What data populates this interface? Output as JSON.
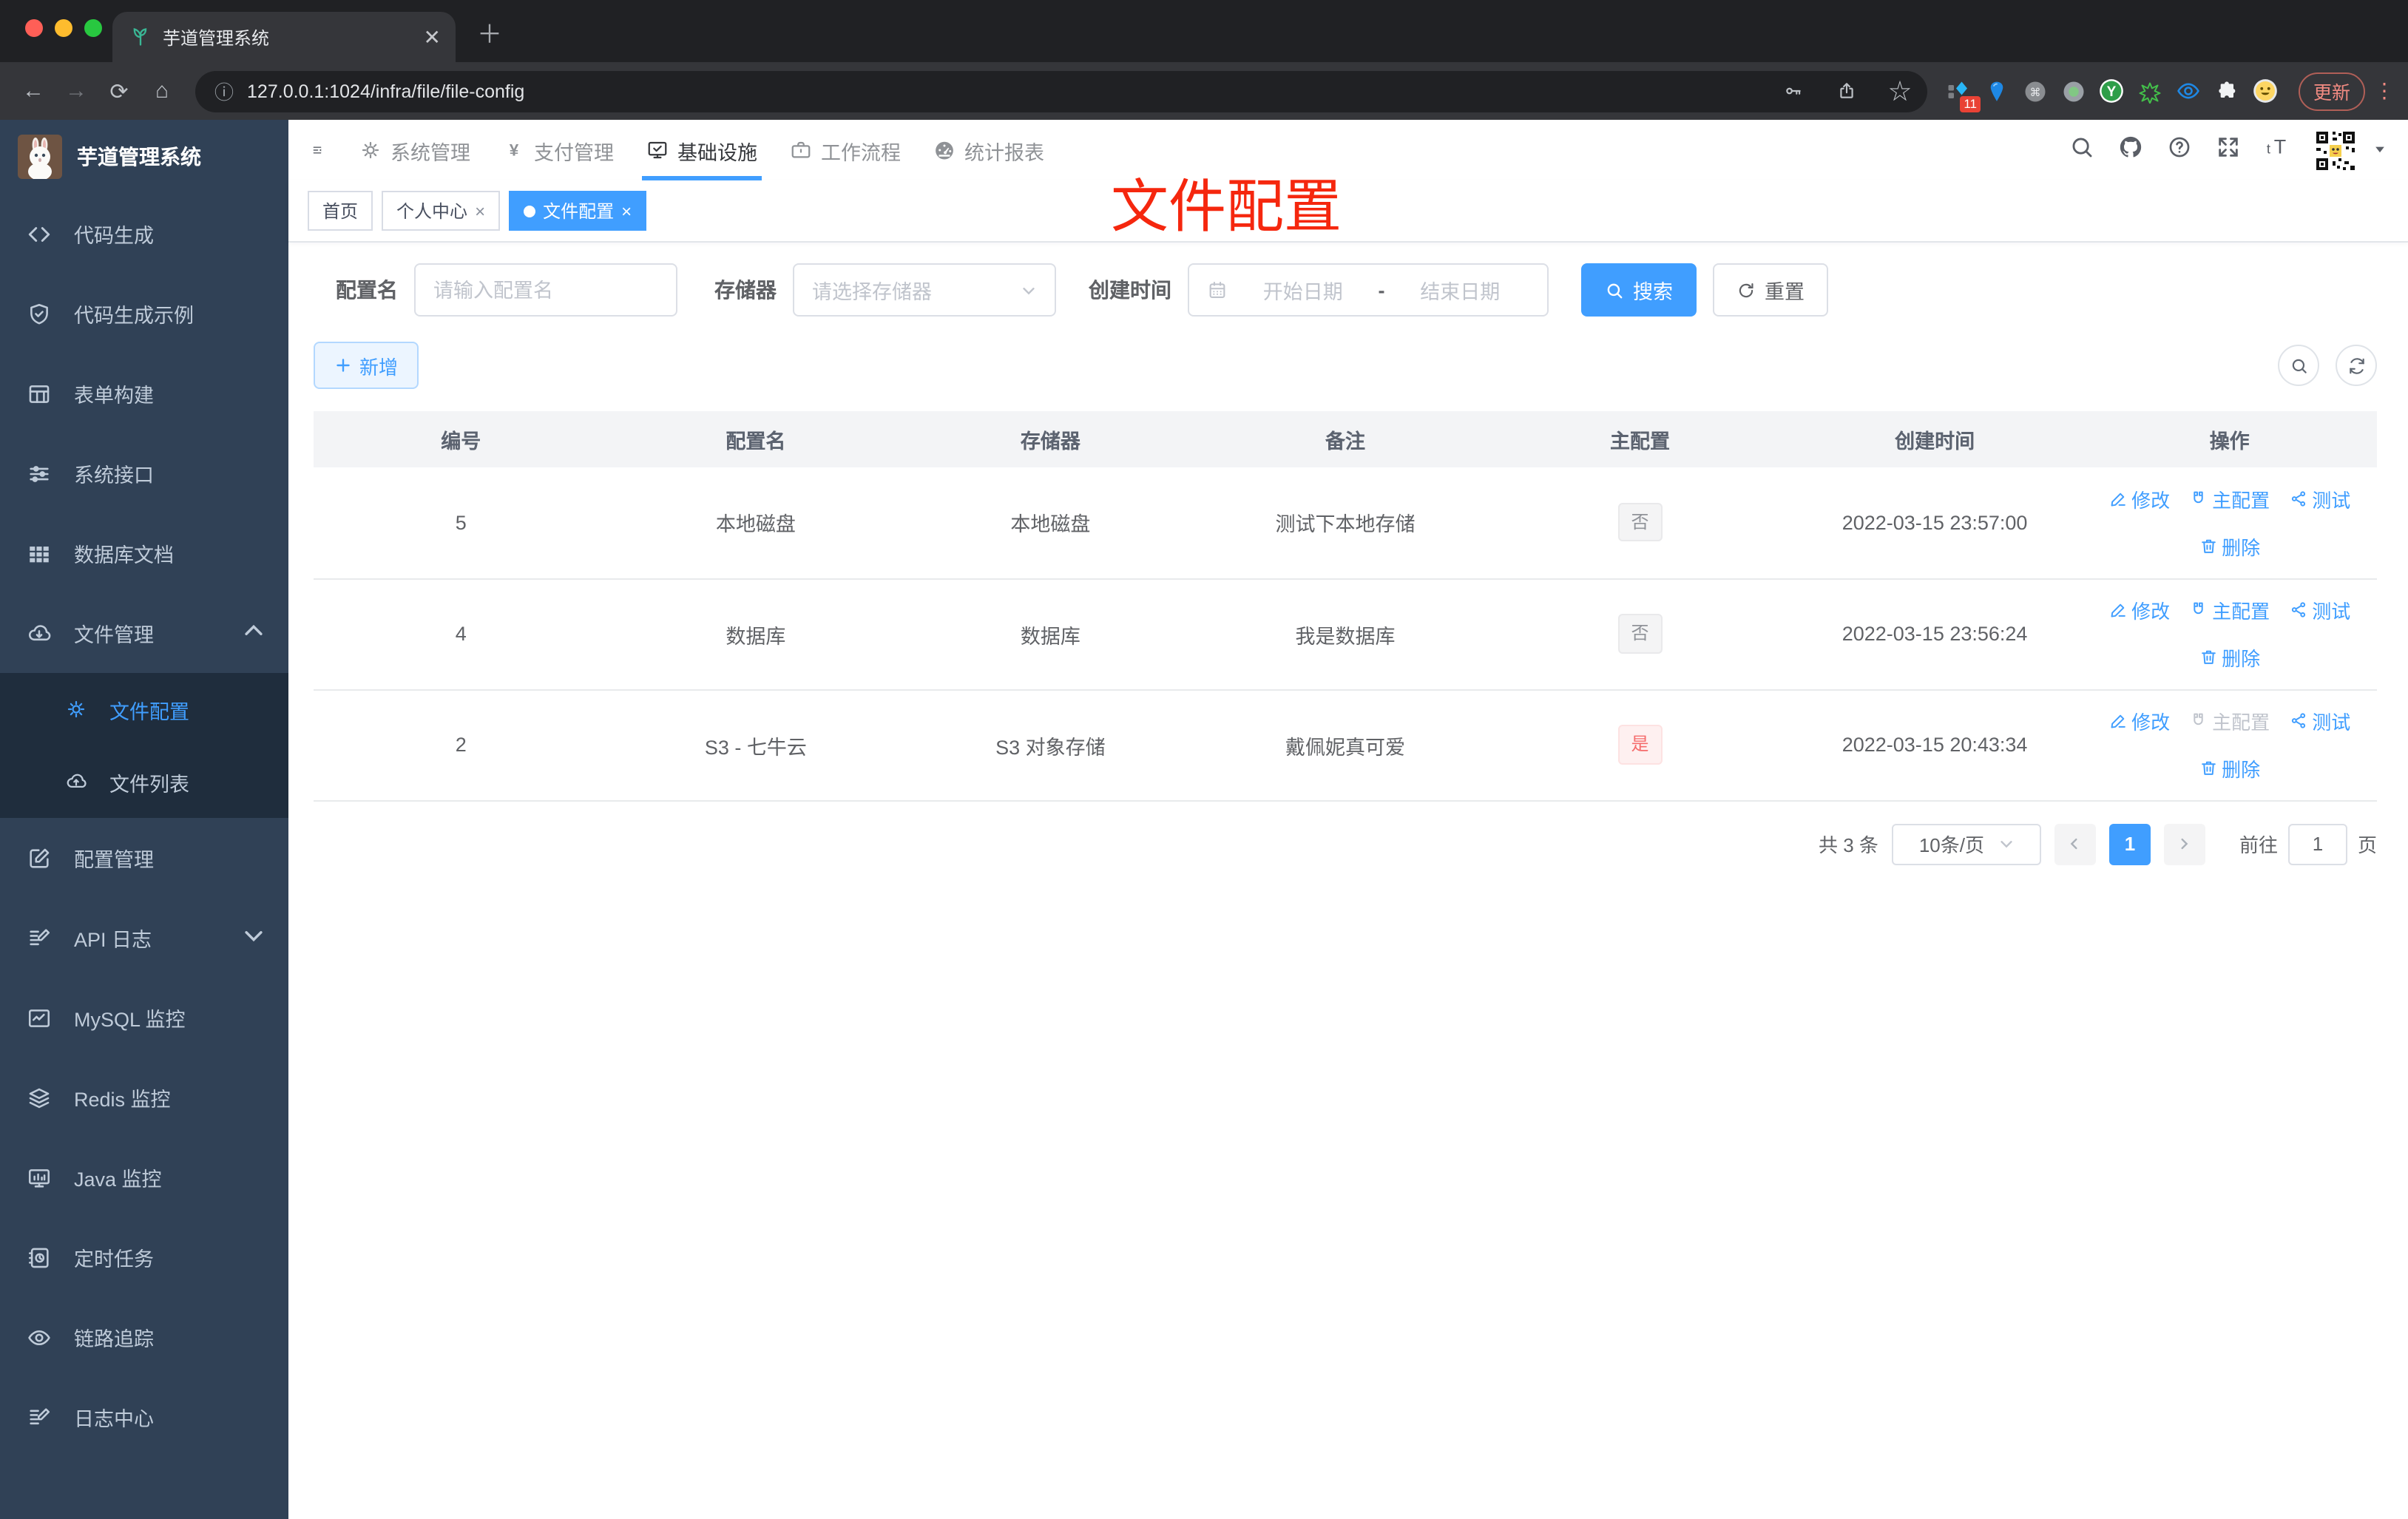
{
  "colors": {
    "primary": "#409eff",
    "danger": "#f56c6c",
    "annotation": "#f5270e",
    "sidebar_bg": "#304156",
    "submenu_bg": "#1f2d3d"
  },
  "browser": {
    "tab_title": "芋道管理系统",
    "url": "127.0.0.1:1024/infra/file/file-config",
    "update_label": "更新",
    "extension_badge": "11"
  },
  "sidebar": {
    "title": "芋道管理系统",
    "items": [
      {
        "key": "code-gen",
        "icon": "code",
        "label": "代码生成"
      },
      {
        "key": "code-gen-demo",
        "icon": "shield-check",
        "label": "代码生成示例"
      },
      {
        "key": "form-builder",
        "icon": "form-table",
        "label": "表单构建"
      },
      {
        "key": "system-api",
        "icon": "sliders",
        "label": "系统接口"
      },
      {
        "key": "db-doc",
        "icon": "grid",
        "label": "数据库文档"
      },
      {
        "key": "file-manage",
        "icon": "cloud-download",
        "label": "文件管理",
        "expanded": true,
        "children": [
          {
            "key": "file-config",
            "icon": "gear",
            "label": "文件配置",
            "active": true
          },
          {
            "key": "file-list",
            "icon": "cloud-upload",
            "label": "文件列表"
          }
        ]
      },
      {
        "key": "config-manage",
        "icon": "edit-square",
        "label": "配置管理"
      },
      {
        "key": "api-log",
        "icon": "doc-edit",
        "label": "API 日志",
        "caret": "down"
      },
      {
        "key": "mysql-monitor",
        "icon": "chart",
        "label": "MySQL 监控"
      },
      {
        "key": "redis-monitor",
        "icon": "layers",
        "label": "Redis 监控"
      },
      {
        "key": "java-monitor",
        "icon": "monitor",
        "label": "Java 监控"
      },
      {
        "key": "cron-job",
        "icon": "task-clock",
        "label": "定时任务"
      },
      {
        "key": "trace",
        "icon": "eye",
        "label": "链路追踪"
      },
      {
        "key": "log-center",
        "icon": "doc-edit",
        "label": "日志中心"
      }
    ]
  },
  "topnav": {
    "menus": [
      {
        "key": "system-manage",
        "icon": "gear",
        "label": "系统管理"
      },
      {
        "key": "payment-manage",
        "icon": "yen",
        "label": "支付管理"
      },
      {
        "key": "infra",
        "icon": "monitor-check",
        "label": "基础设施",
        "active": true
      },
      {
        "key": "workflow",
        "icon": "briefcase",
        "label": "工作流程"
      },
      {
        "key": "report",
        "icon": "dashboard",
        "label": "统计报表"
      }
    ],
    "right_icons": [
      "search",
      "github",
      "question",
      "fullscreen",
      "font-size"
    ]
  },
  "tags_view": {
    "tags": [
      {
        "key": "home",
        "label": "首页",
        "closable": false,
        "active": false
      },
      {
        "key": "profile",
        "label": "个人中心",
        "closable": true,
        "active": false
      },
      {
        "key": "file-config",
        "label": "文件配置",
        "closable": true,
        "active": true
      }
    ]
  },
  "annotation": {
    "text": "文件配置"
  },
  "filters": {
    "config_name": {
      "label": "配置名",
      "placeholder": "请输入配置名"
    },
    "storage": {
      "label": "存储器",
      "placeholder": "请选择存储器"
    },
    "create_time": {
      "label": "创建时间",
      "start_placeholder": "开始日期",
      "separator": "-",
      "end_placeholder": "结束日期"
    },
    "search_label": "搜索",
    "reset_label": "重置"
  },
  "toolbar": {
    "add_label": "新增"
  },
  "table": {
    "columns": [
      "编号",
      "配置名",
      "存储器",
      "备注",
      "主配置",
      "创建时间",
      "操作"
    ],
    "rows": [
      {
        "id": "5",
        "name": "本地磁盘",
        "storage": "本地磁盘",
        "remark": "测试下本地存储",
        "master": {
          "text": "否",
          "type": "info"
        },
        "created_at": "2022-03-15 23:57:00",
        "actions": [
          {
            "key": "edit",
            "icon": "pencil",
            "label": "修改"
          },
          {
            "key": "master",
            "icon": "magnet",
            "label": "主配置"
          },
          {
            "key": "test",
            "icon": "share",
            "label": "测试"
          },
          {
            "key": "delete",
            "icon": "trash",
            "label": "删除"
          }
        ]
      },
      {
        "id": "4",
        "name": "数据库",
        "storage": "数据库",
        "remark": "我是数据库",
        "master": {
          "text": "否",
          "type": "info"
        },
        "created_at": "2022-03-15 23:56:24",
        "actions": [
          {
            "key": "edit",
            "icon": "pencil",
            "label": "修改"
          },
          {
            "key": "master",
            "icon": "magnet",
            "label": "主配置"
          },
          {
            "key": "test",
            "icon": "share",
            "label": "测试"
          },
          {
            "key": "delete",
            "icon": "trash",
            "label": "删除"
          }
        ]
      },
      {
        "id": "2",
        "name": "S3 - 七牛云",
        "storage": "S3 对象存储",
        "remark": "戴佩妮真可爱",
        "master": {
          "text": "是",
          "type": "danger"
        },
        "created_at": "2022-03-15 20:43:34",
        "actions": [
          {
            "key": "edit",
            "icon": "pencil",
            "label": "修改"
          },
          {
            "key": "master",
            "icon": "magnet",
            "label": "主配置",
            "disabled": true
          },
          {
            "key": "test",
            "icon": "share",
            "label": "测试"
          },
          {
            "key": "delete",
            "icon": "trash",
            "label": "删除"
          }
        ]
      }
    ]
  },
  "pagination": {
    "total": "共 3 条",
    "page_size": "10条/页",
    "current_page": "1",
    "goto_label": "前往",
    "goto_value": "1",
    "page_unit": "页"
  }
}
